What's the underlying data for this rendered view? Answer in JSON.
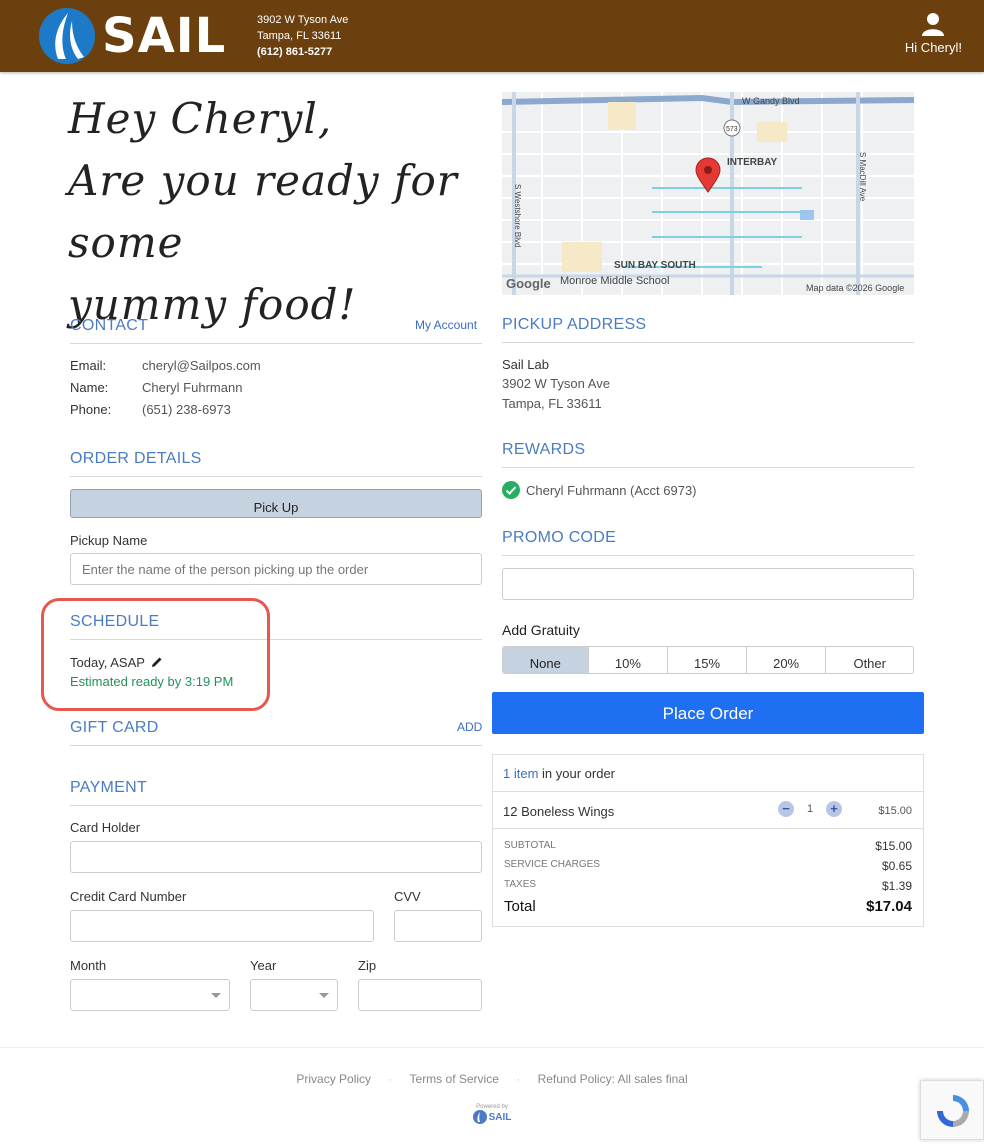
{
  "header": {
    "brand": "SAIL",
    "address_line1": "3902 W Tyson Ave",
    "address_line2": "Tampa, FL 33611",
    "phone": "(612) 861-5277",
    "greeting": "Hi Cheryl!",
    "bg_color": "#6b400e"
  },
  "hero": {
    "line1": "Hey Cheryl,",
    "line2": "Are you ready for some",
    "line3": "yummy food!"
  },
  "map": {
    "labels": [
      "W Gandy Blvd",
      "573",
      "INTERBAY",
      "S MacDill Ave",
      "S Westshore Blvd",
      "SUN BAY SOUTH",
      "Monroe Middle School",
      "Google",
      "Map data ©2026 Google"
    ]
  },
  "contact": {
    "title": "CONTACT",
    "link": "My Account",
    "email_label": "Email:",
    "email": "cheryl@Sailpos.com",
    "name_label": "Name:",
    "name": "Cheryl Fuhrmann",
    "phone_label": "Phone:",
    "phone": "(651) 238-6973"
  },
  "order_details": {
    "title": "ORDER DETAILS",
    "mode": "Pick Up",
    "pickup_name_label": "Pickup Name",
    "pickup_name_placeholder": "Enter the name of the person picking up the order"
  },
  "schedule": {
    "title": "SCHEDULE",
    "time": "Today, ASAP",
    "estimate": "Estimated ready by 3:19 PM"
  },
  "gift_card": {
    "title": "GIFT CARD",
    "link": "ADD"
  },
  "payment": {
    "title": "PAYMENT",
    "card_holder": "Card Holder",
    "card_number": "Credit Card Number",
    "cvv": "CVV",
    "month": "Month",
    "year": "Year",
    "zip": "Zip"
  },
  "pickup_address": {
    "title": "PICKUP ADDRESS",
    "name": "Sail Lab",
    "line1": "3902 W Tyson Ave",
    "line2": "Tampa, FL 33611"
  },
  "rewards": {
    "title": "REWARDS",
    "account": "Cheryl Fuhrmann (Acct 6973)"
  },
  "promo": {
    "title": "PROMO CODE"
  },
  "gratuity": {
    "label": "Add Gratuity",
    "options": [
      "None",
      "10%",
      "15%",
      "20%",
      "Other"
    ],
    "selected": "None"
  },
  "place_order": "Place Order",
  "cart": {
    "count_link": "1 item",
    "count_suffix": " in your order",
    "items": [
      {
        "name": "12 Boneless Wings",
        "qty": "1",
        "price": "$15.00"
      }
    ],
    "subtotal_label": "SUBTOTAL",
    "subtotal": "$15.00",
    "service_label": "SERVICE CHARGES",
    "service": "$0.65",
    "taxes_label": "TAXES",
    "taxes": "$1.39",
    "total_label": "Total",
    "total": "$17.04"
  },
  "footer": {
    "privacy": "Privacy Policy",
    "terms": "Terms of Service",
    "refund": "Refund Policy: All sales final",
    "powered": "Powered by",
    "powered_brand": "SAIL"
  }
}
